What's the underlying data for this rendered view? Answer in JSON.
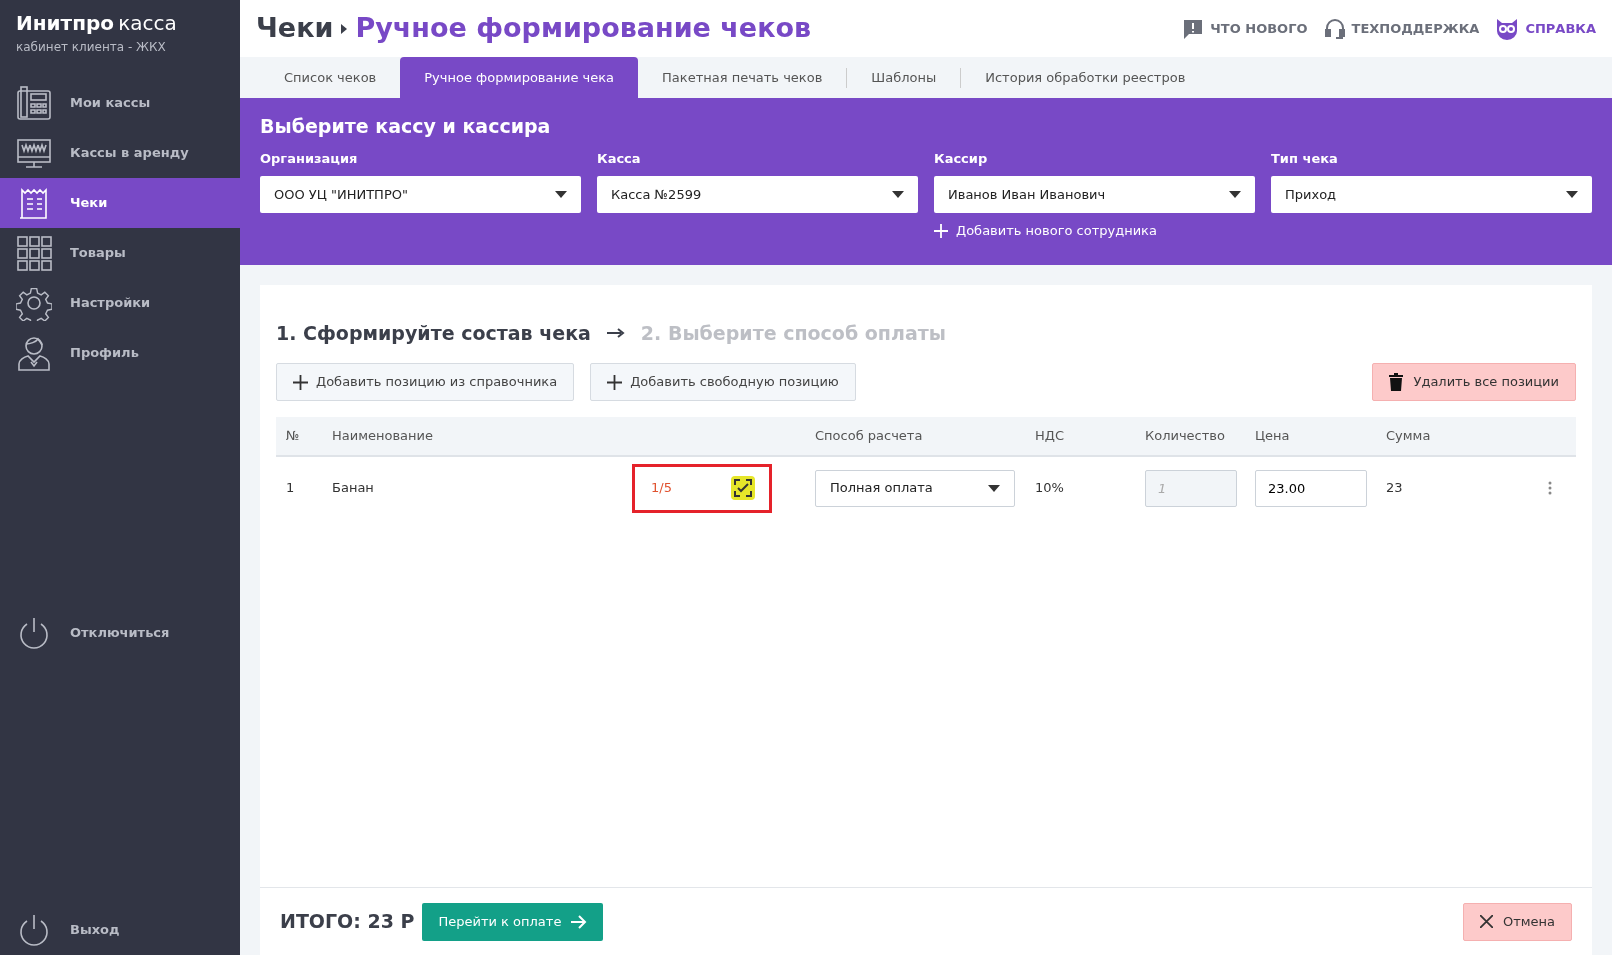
{
  "brand": {
    "name": "Инитпро",
    "product": "касса",
    "subtitle": "кабинет клиента - ЖКХ"
  },
  "sidebar": {
    "items": [
      {
        "label": "Мои кассы",
        "selected": false
      },
      {
        "label": "Кассы в аренду",
        "selected": false
      },
      {
        "label": "Чеки",
        "selected": true
      },
      {
        "label": "Товары",
        "selected": false
      },
      {
        "label": "Настройки",
        "selected": false
      },
      {
        "label": "Профиль",
        "selected": false
      }
    ],
    "disconnect": "Отключиться",
    "logout": "Выход"
  },
  "header": {
    "breadcrumb": "Чеки",
    "title": "Ручное формирование чеков",
    "links": [
      "ЧТО НОВОГО",
      "ТЕХПОДДЕРЖКА",
      "СПРАВКА"
    ]
  },
  "tabs": [
    {
      "label": "Список чеков",
      "selected": false
    },
    {
      "label": "Ручное формирование чека",
      "selected": true
    },
    {
      "label": "Пакетная печать чеков",
      "selected": false
    },
    {
      "label": "Шаблоны",
      "selected": false
    },
    {
      "label": "История обработки реестров",
      "selected": false
    }
  ],
  "selection": {
    "title": "Выберите кассу и кассира",
    "fields": [
      {
        "label": "Организация",
        "value": "ООО УЦ \"ИНИТПРО\""
      },
      {
        "label": "Касса",
        "value": "Касса №2599"
      },
      {
        "label": "Кассир",
        "value": "Иванов Иван Иванович"
      },
      {
        "label": "Тип чека",
        "value": "Приход"
      }
    ],
    "add_employee": "Добавить нового сотрудника"
  },
  "steps": [
    {
      "label": "1. Сформируйте состав чека",
      "selected": true
    },
    {
      "label": "2. Выберите способ оплаты",
      "selected": false
    }
  ],
  "buttons": {
    "add_from_catalog": "Добавить позицию из справочника",
    "add_free": "Добавить свободную позицию",
    "delete_all": "Удалить все позиции"
  },
  "table": {
    "columns": [
      "№",
      "Наименование",
      "Способ расчета",
      "НДС",
      "Количество",
      "Цена",
      "Сумма"
    ],
    "rows": [
      {
        "number": "1",
        "name": "Банан",
        "marking": "1/5",
        "highlighted": true,
        "payment_method": "Полная оплата",
        "vat": "10%",
        "quantity": {
          "placeholder": "1",
          "disabled": true
        },
        "price": "23.00",
        "sum": "23"
      }
    ]
  },
  "footer": {
    "total": "ИТОГО: 23 Р",
    "pay": "Перейти к оплате",
    "cancel": "Отмена"
  }
}
